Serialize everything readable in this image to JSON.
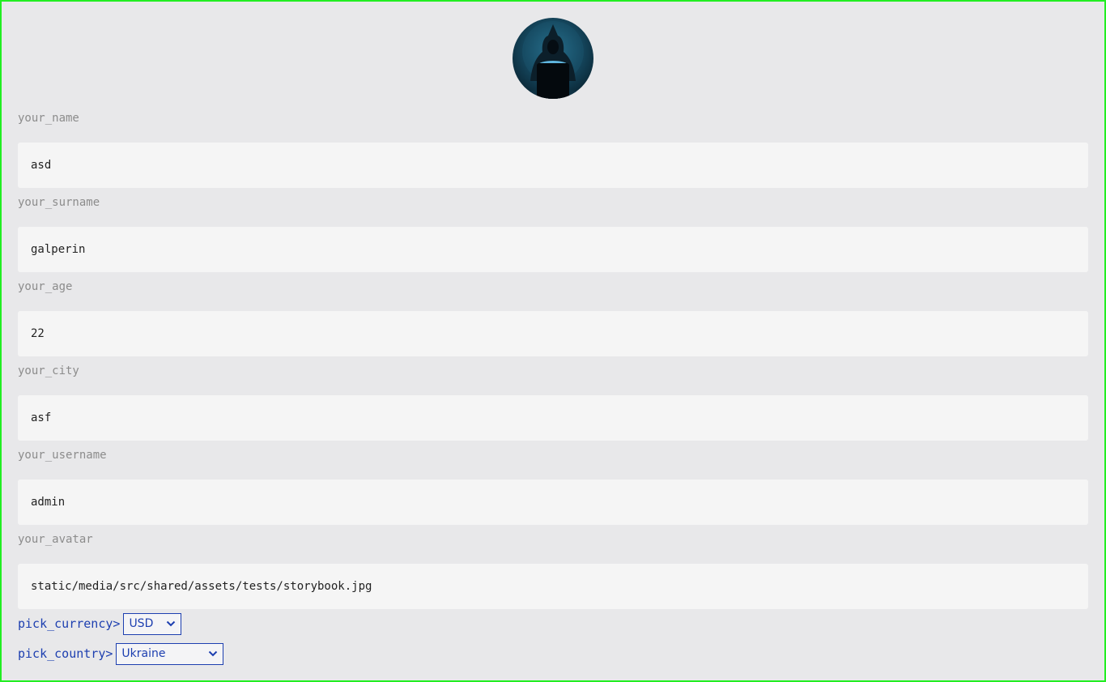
{
  "avatar": {
    "icon": "hooded-hacker-avatar",
    "colors": {
      "ring": "#0a2533",
      "glow": "#6fd0ff"
    }
  },
  "fields": [
    {
      "label": "your_name",
      "value": "asd"
    },
    {
      "label": "your_surname",
      "value": "galperin"
    },
    {
      "label": "your_age",
      "value": "22"
    },
    {
      "label": "your_city",
      "value": "asf"
    },
    {
      "label": "your_username",
      "value": "admin"
    },
    {
      "label": "your_avatar",
      "value": "static/media/src/shared/assets/tests/storybook.jpg"
    }
  ],
  "currency": {
    "label": "pick_currency>",
    "selected": "USD"
  },
  "country": {
    "label": "pick_country>",
    "selected": "Ukraine"
  },
  "colors": {
    "accent": "#1d3fb0",
    "background": "#e8e8ea",
    "field": "#f5f5f5",
    "label": "#8c8c8c",
    "frame": "#22ee22"
  }
}
